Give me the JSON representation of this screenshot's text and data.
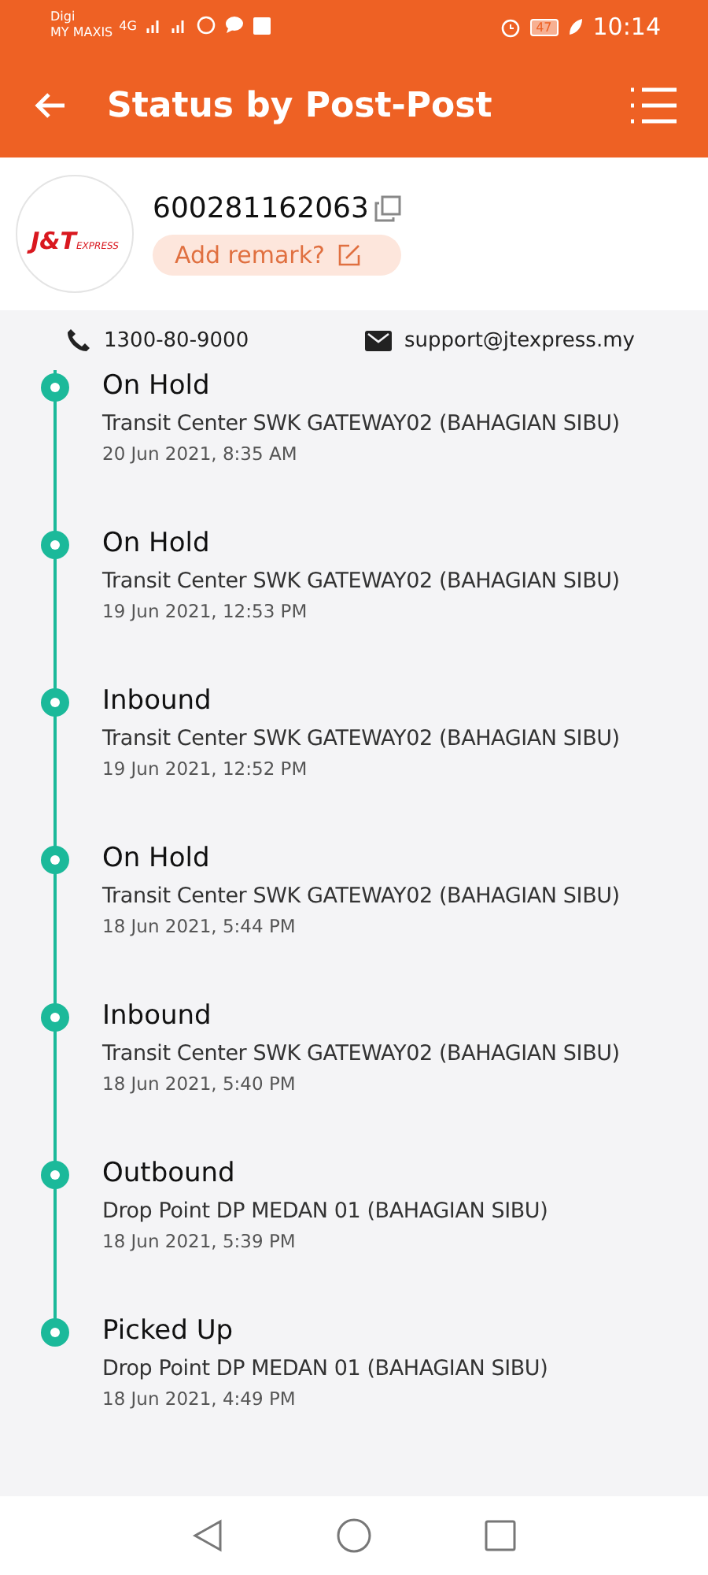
{
  "status_bar": {
    "carrier_1": "Digi",
    "carrier_2": "MY MAXIS",
    "network": "4G",
    "battery": "47",
    "time": "10:14"
  },
  "header": {
    "title": "Status by Post-Post"
  },
  "parcel": {
    "logo": {
      "brand": "J&T",
      "tagline": "EXPRESS"
    },
    "tracking_number": "600281162063",
    "remark_button": "Add remark?"
  },
  "contacts": {
    "phone": "1300-80-9000",
    "email": "support@jtexpress.my"
  },
  "events": [
    {
      "status": "On Hold",
      "location": "Transit Center SWK GATEWAY02 (BAHAGIAN SIBU)",
      "time": "20 Jun 2021, 8:35 AM"
    },
    {
      "status": "On Hold",
      "location": "Transit Center SWK GATEWAY02 (BAHAGIAN SIBU)",
      "time": "19 Jun 2021, 12:53 PM"
    },
    {
      "status": "Inbound",
      "location": "Transit Center SWK GATEWAY02 (BAHAGIAN SIBU)",
      "time": "19 Jun 2021, 12:52 PM"
    },
    {
      "status": "On Hold",
      "location": "Transit Center SWK GATEWAY02 (BAHAGIAN SIBU)",
      "time": "18 Jun 2021, 5:44 PM"
    },
    {
      "status": "Inbound",
      "location": "Transit Center SWK GATEWAY02 (BAHAGIAN SIBU)",
      "time": "18 Jun 2021, 5:40 PM"
    },
    {
      "status": "Outbound",
      "location": "Drop Point DP MEDAN 01 (BAHAGIAN SIBU)",
      "time": "18 Jun 2021, 5:39 PM"
    },
    {
      "status": "Picked Up",
      "location": "Drop Point DP MEDAN 01 (BAHAGIAN SIBU)",
      "time": "18 Jun 2021, 4:49 PM"
    }
  ]
}
